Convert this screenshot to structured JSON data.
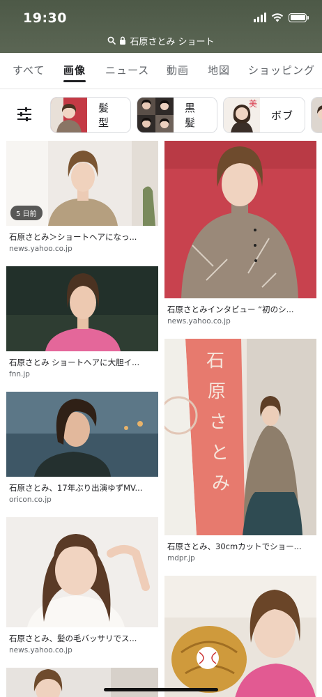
{
  "status_bar": {
    "time": "19:30"
  },
  "url_bar": {
    "query": "石原さとみ ショート"
  },
  "tabs": [
    {
      "label": "すべて"
    },
    {
      "label": "画像"
    },
    {
      "label": "ニュース"
    },
    {
      "label": "動画"
    },
    {
      "label": "地図"
    },
    {
      "label": "ショッピング"
    }
  ],
  "active_tab": "画像",
  "chips": [
    {
      "label": "髪型"
    },
    {
      "label": "黒髪"
    },
    {
      "label": "ボブ"
    }
  ],
  "results": [
    {
      "title": "石原さとみ＞ショートヘアになっ...",
      "source": "news.yahoo.co.jp",
      "badge": "5 日前"
    },
    {
      "title": "石原さとみインタビュー “初のシ...",
      "source": "news.yahoo.co.jp"
    },
    {
      "title": "石原さとみ ショートヘアに大胆イ...",
      "source": "fnn.jp"
    },
    {
      "title": "石原さとみ、17年ぶり出演ゆずMV...",
      "source": "oricon.co.jp"
    },
    {
      "title": "石原さとみ、30cmカットでショー...",
      "source": "mdpr.jp"
    },
    {
      "title": "石原さとみ、髪の毛バッサリでス...",
      "source": "news.yahoo.co.jp"
    },
    {
      "title": "",
      "source": ""
    },
    {
      "title": "",
      "source": ""
    }
  ],
  "colors": {
    "chrome_bg": "#4f5b49",
    "active_tab": "#202124",
    "inactive_tab": "#5f6368",
    "source_text": "#5f6368"
  }
}
